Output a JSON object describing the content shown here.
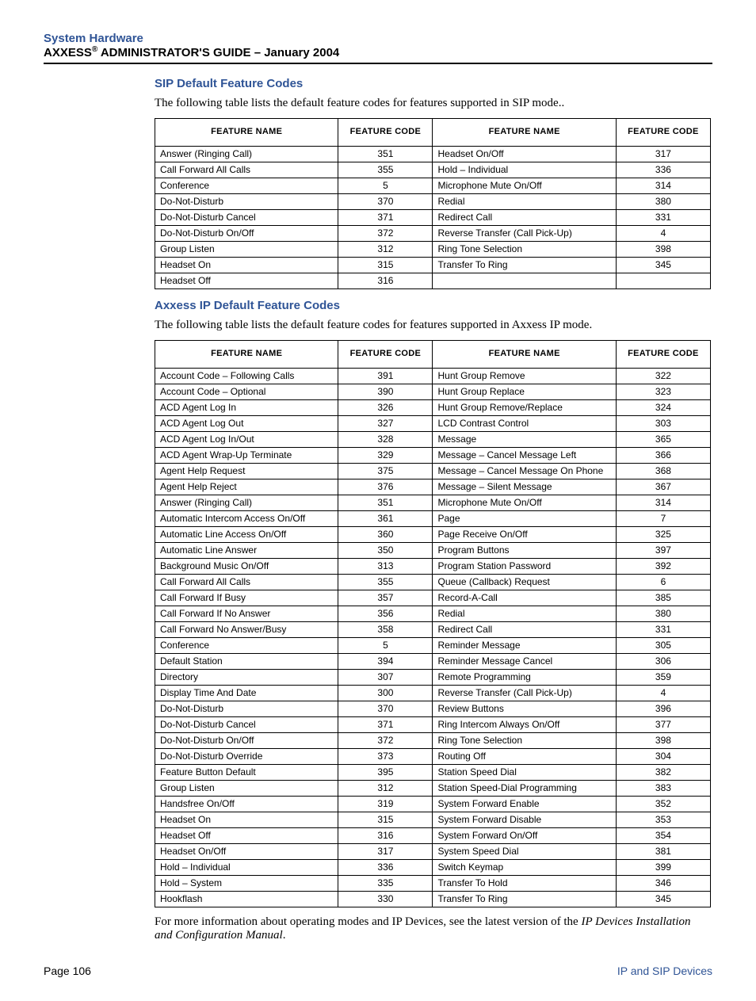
{
  "header": {
    "line1": "System Hardware",
    "brand": "AXXESS",
    "reg": "®",
    "line2_rest": " ADMINISTRATOR'S GUIDE – January 2004"
  },
  "section1": {
    "heading": "SIP Default Feature Codes",
    "intro": "The following table lists the default feature codes for features supported in SIP mode..",
    "thead": {
      "c1": "FEATURE NAME",
      "c2": "FEATURE CODE",
      "c3": "FEATURE NAME",
      "c4": "FEATURE CODE"
    },
    "rows": [
      {
        "n1": "Answer (Ringing Call)",
        "c1": "351",
        "n2": "Headset On/Off",
        "c2": "317"
      },
      {
        "n1": "Call Forward All Calls",
        "c1": "355",
        "n2": "Hold – Individual",
        "c2": "336"
      },
      {
        "n1": "Conference",
        "c1": "5",
        "n2": "Microphone Mute On/Off",
        "c2": "314"
      },
      {
        "n1": "Do-Not-Disturb",
        "c1": "370",
        "n2": "Redial",
        "c2": "380"
      },
      {
        "n1": "Do-Not-Disturb Cancel",
        "c1": "371",
        "n2": "Redirect Call",
        "c2": "331"
      },
      {
        "n1": "Do-Not-Disturb On/Off",
        "c1": "372",
        "n2": "Reverse Transfer (Call Pick-Up)",
        "c2": "4"
      },
      {
        "n1": "Group Listen",
        "c1": "312",
        "n2": "Ring Tone Selection",
        "c2": "398"
      },
      {
        "n1": "Headset On",
        "c1": "315",
        "n2": "Transfer To Ring",
        "c2": "345"
      },
      {
        "n1": "Headset Off",
        "c1": "316",
        "n2": "",
        "c2": ""
      }
    ]
  },
  "section2": {
    "heading": "Axxess IP Default Feature Codes",
    "intro": "The following table lists the default feature codes for features supported in Axxess IP mode.",
    "thead": {
      "c1": "FEATURE NAME",
      "c2": "FEATURE CODE",
      "c3": "FEATURE NAME",
      "c4": "FEATURE CODE"
    },
    "rows": [
      {
        "n1": "Account Code – Following Calls",
        "c1": "391",
        "n2": "Hunt Group Remove",
        "c2": "322"
      },
      {
        "n1": "Account Code – Optional",
        "c1": "390",
        "n2": "Hunt Group Replace",
        "c2": "323"
      },
      {
        "n1": "ACD Agent Log In",
        "c1": "326",
        "n2": "Hunt Group Remove/Replace",
        "c2": "324"
      },
      {
        "n1": "ACD Agent Log Out",
        "c1": "327",
        "n2": "LCD Contrast Control",
        "c2": "303"
      },
      {
        "n1": "ACD Agent Log In/Out",
        "c1": "328",
        "n2": "Message",
        "c2": "365"
      },
      {
        "n1": "ACD Agent Wrap-Up Terminate",
        "c1": "329",
        "n2": "Message – Cancel Message Left",
        "c2": "366"
      },
      {
        "n1": "Agent Help Request",
        "c1": "375",
        "n2": "Message – Cancel Message On Phone",
        "c2": "368"
      },
      {
        "n1": "Agent Help Reject",
        "c1": "376",
        "n2": "Message – Silent Message",
        "c2": "367"
      },
      {
        "n1": "Answer (Ringing Call)",
        "c1": "351",
        "n2": "Microphone Mute On/Off",
        "c2": "314"
      },
      {
        "n1": "Automatic Intercom Access On/Off",
        "c1": "361",
        "n2": "Page",
        "c2": "7"
      },
      {
        "n1": "Automatic Line Access On/Off",
        "c1": "360",
        "n2": "Page Receive On/Off",
        "c2": "325"
      },
      {
        "n1": "Automatic Line Answer",
        "c1": "350",
        "n2": "Program Buttons",
        "c2": "397"
      },
      {
        "n1": "Background Music On/Off",
        "c1": "313",
        "n2": "Program Station Password",
        "c2": "392"
      },
      {
        "n1": "Call Forward All Calls",
        "c1": "355",
        "n2": "Queue (Callback) Request",
        "c2": "6"
      },
      {
        "n1": "Call Forward If Busy",
        "c1": "357",
        "n2": "Record-A-Call",
        "c2": "385"
      },
      {
        "n1": "Call Forward If No Answer",
        "c1": "356",
        "n2": "Redial",
        "c2": "380"
      },
      {
        "n1": "Call Forward No Answer/Busy",
        "c1": "358",
        "n2": "Redirect Call",
        "c2": "331"
      },
      {
        "n1": "Conference",
        "c1": "5",
        "n2": "Reminder Message",
        "c2": "305"
      },
      {
        "n1": "Default Station",
        "c1": "394",
        "n2": "Reminder Message Cancel",
        "c2": "306"
      },
      {
        "n1": "Directory",
        "c1": "307",
        "n2": "Remote Programming",
        "c2": "359"
      },
      {
        "n1": "Display Time And Date",
        "c1": "300",
        "n2": "Reverse Transfer (Call Pick-Up)",
        "c2": "4"
      },
      {
        "n1": "Do-Not-Disturb",
        "c1": "370",
        "n2": "Review Buttons",
        "c2": "396"
      },
      {
        "n1": "Do-Not-Disturb Cancel",
        "c1": "371",
        "n2": "Ring Intercom Always On/Off",
        "c2": "377"
      },
      {
        "n1": "Do-Not-Disturb On/Off",
        "c1": "372",
        "n2": "Ring Tone Selection",
        "c2": "398"
      },
      {
        "n1": "Do-Not-Disturb Override",
        "c1": "373",
        "n2": "Routing Off",
        "c2": "304"
      },
      {
        "n1": "Feature Button Default",
        "c1": "395",
        "n2": "Station Speed Dial",
        "c2": "382"
      },
      {
        "n1": "Group Listen",
        "c1": "312",
        "n2": "Station Speed-Dial Programming",
        "c2": "383"
      },
      {
        "n1": "Handsfree On/Off",
        "c1": "319",
        "n2": "System Forward Enable",
        "c2": "352"
      },
      {
        "n1": "Headset On",
        "c1": "315",
        "n2": "System Forward Disable",
        "c2": "353"
      },
      {
        "n1": "Headset Off",
        "c1": "316",
        "n2": "System Forward On/Off",
        "c2": "354"
      },
      {
        "n1": "Headset On/Off",
        "c1": "317",
        "n2": "System Speed Dial",
        "c2": "381"
      },
      {
        "n1": "Hold – Individual",
        "c1": "336",
        "n2": "Switch Keymap",
        "c2": "399"
      },
      {
        "n1": "Hold – System",
        "c1": "335",
        "n2": "Transfer To Hold",
        "c2": "346"
      },
      {
        "n1": "Hookflash",
        "c1": "330",
        "n2": "Transfer To Ring",
        "c2": "345"
      }
    ]
  },
  "closing": {
    "pre": " For more information about operating modes and IP Devices, see the latest version of the ",
    "ital": "IP Devices Installation and Configuration Manual",
    "post": "."
  },
  "footer": {
    "page_label": "Page ",
    "page_no": "106",
    "right": "IP and SIP Devices"
  }
}
